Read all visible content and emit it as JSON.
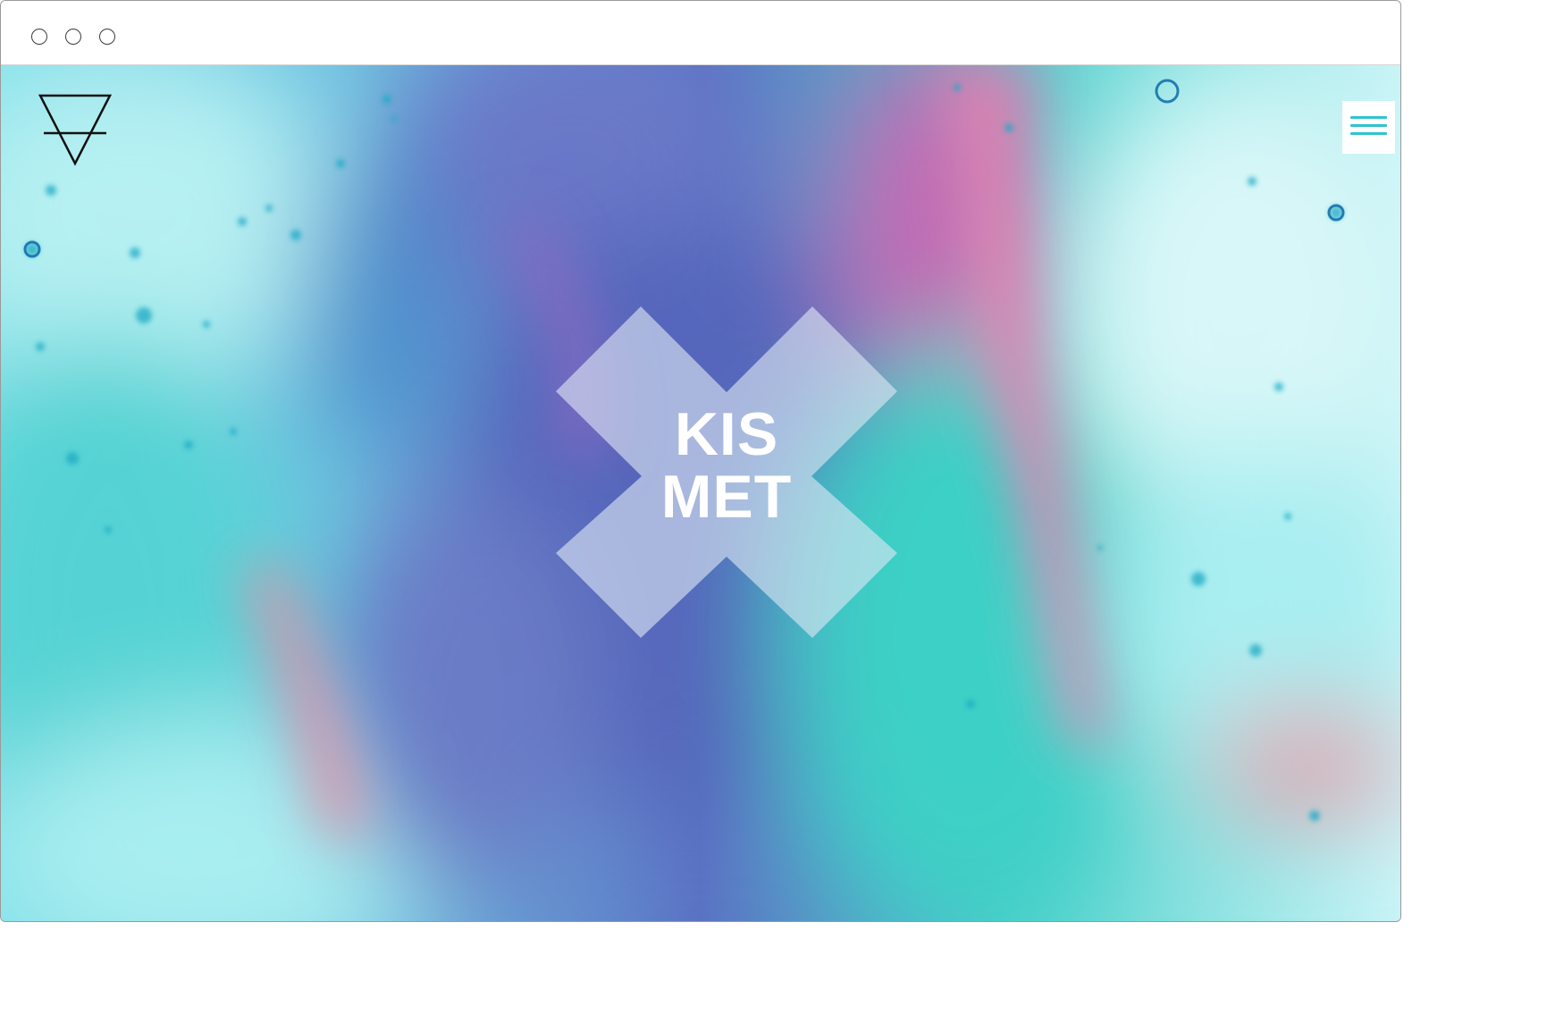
{
  "window": {
    "controls": [
      "close-circle",
      "minimize-circle",
      "zoom-circle"
    ]
  },
  "site": {
    "logo_icon": "earth-alchemy-symbol-icon",
    "menu_icon": "hamburger-menu-icon",
    "brand_line_1": "KIS",
    "brand_line_2": "MET"
  },
  "colors": {
    "teal": "#3fd3c8",
    "cyan_light": "#bdf3f6",
    "purple": "#5a6ec0",
    "pink": "#ef7fa6",
    "menu_accent": "#2fc4cf",
    "x_overlay": "#d8e4f2"
  }
}
